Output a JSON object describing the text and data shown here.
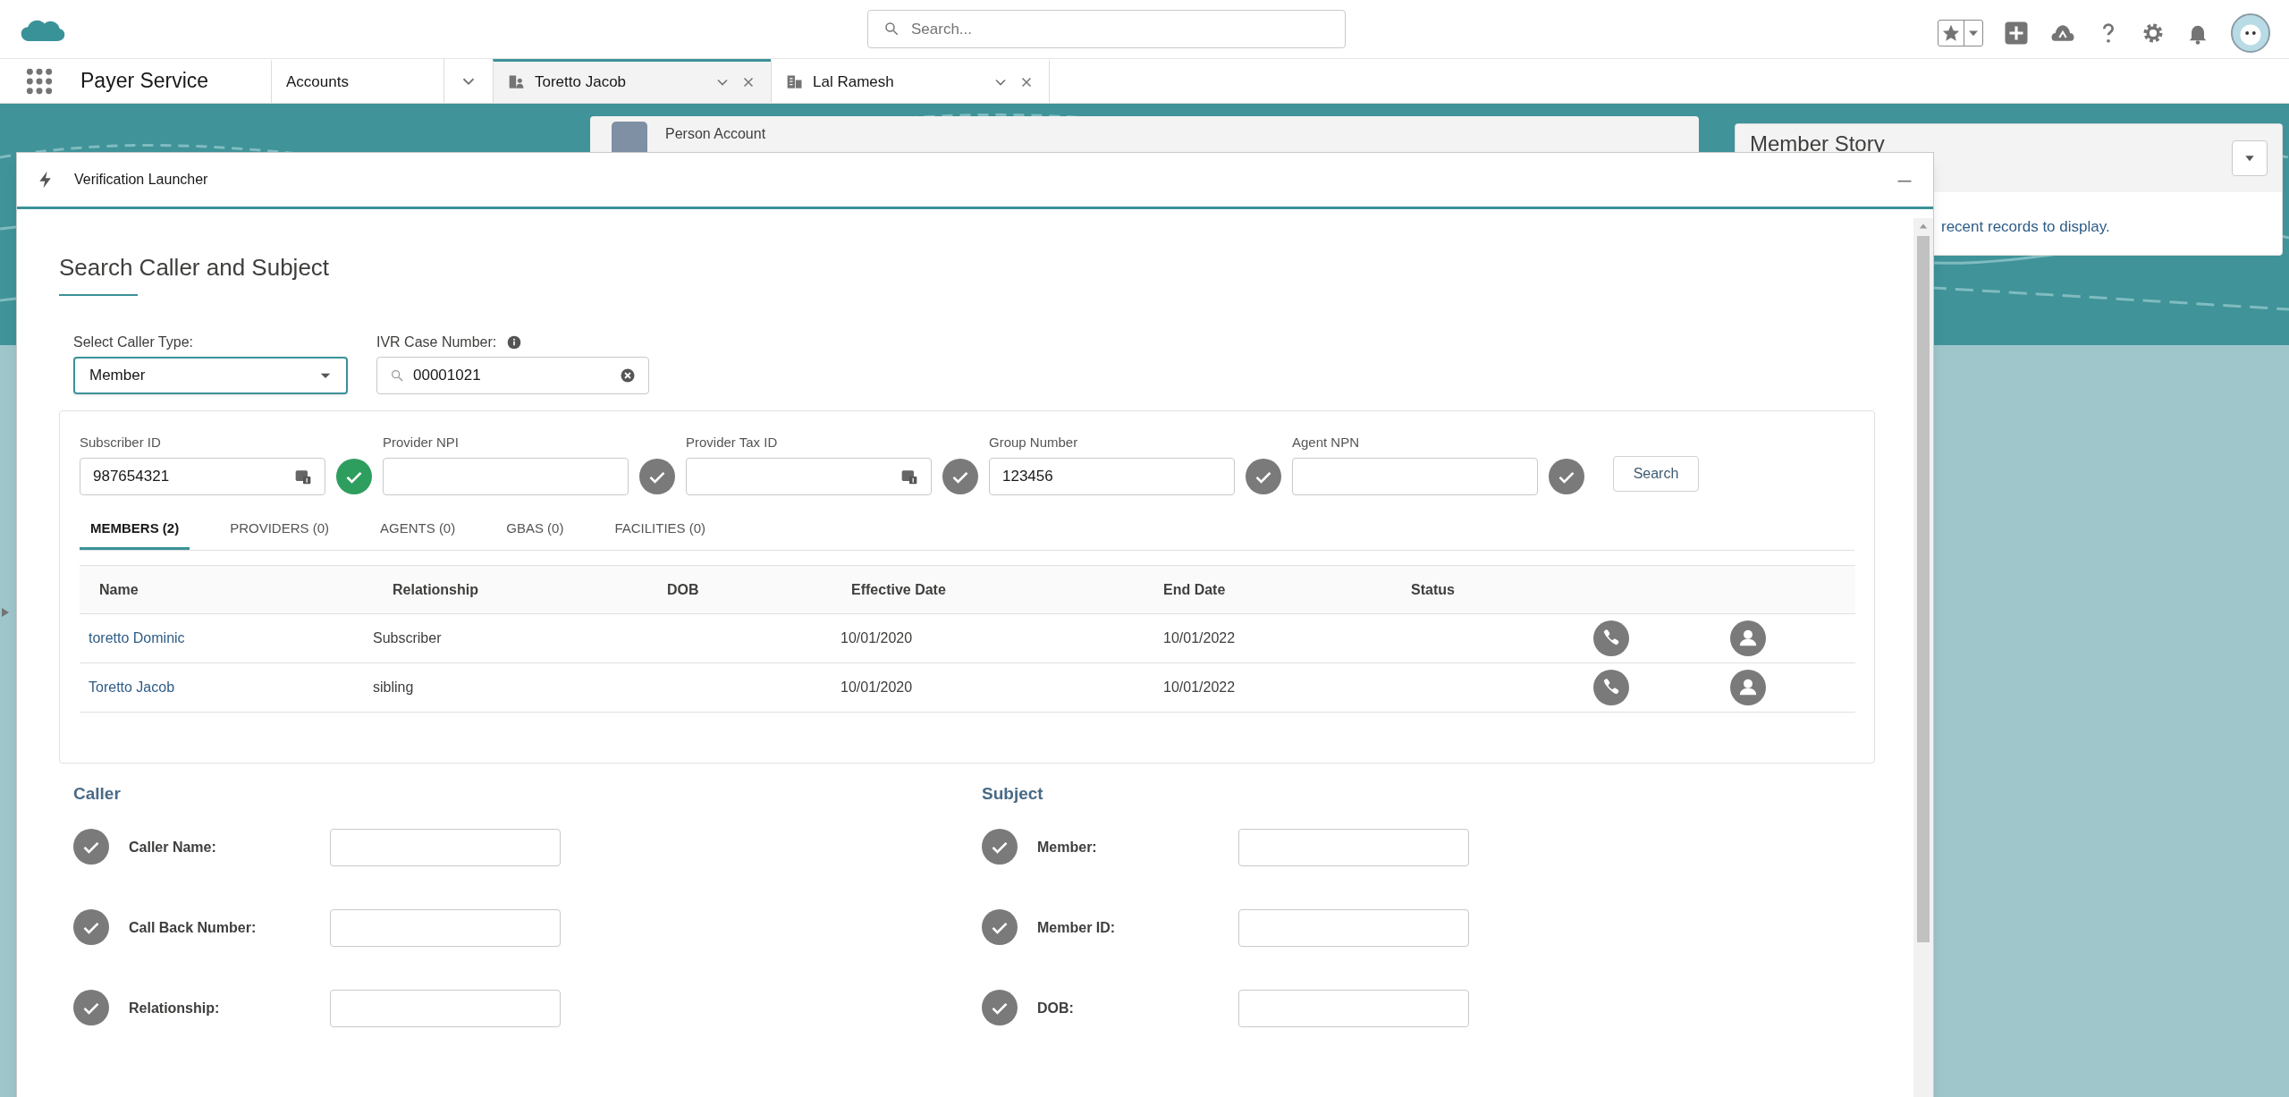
{
  "header": {
    "search": {
      "placeholder": "Search..."
    }
  },
  "nav": {
    "app_name": "Payer Service",
    "tabs": [
      {
        "label": "Accounts",
        "kind": "object",
        "selected": false
      },
      {
        "label": "Toretto Jacob",
        "kind": "person",
        "selected": true
      },
      {
        "label": "Lal Ramesh",
        "kind": "business",
        "selected": false
      }
    ]
  },
  "person_account": {
    "label": "Person Account"
  },
  "member_story": {
    "title": "Member Story",
    "message": "recent records to display."
  },
  "modal": {
    "title": "Verification Launcher",
    "heading": "Search Caller and Subject",
    "caller_type": {
      "label": "Select Caller Type:",
      "value": "Member"
    },
    "ivr": {
      "label": "IVR Case Number:",
      "value": "00001021"
    },
    "search_fields": [
      {
        "label": "Subscriber ID",
        "value": "987654321",
        "lookup": true,
        "verified": true
      },
      {
        "label": "Provider NPI",
        "lookup": false,
        "verified": false
      },
      {
        "label": "Provider Tax ID",
        "lookup": true,
        "verified": false
      },
      {
        "label": "Group Number",
        "value": "123456",
        "lookup": false,
        "verified": false
      },
      {
        "label": "Agent NPN",
        "lookup": false,
        "verified": false
      }
    ],
    "search_button": "Search",
    "result_tabs": [
      {
        "label": "MEMBERS (2)",
        "selected": true
      },
      {
        "label": "PROVIDERS (0)",
        "selected": false
      },
      {
        "label": "AGENTS (0)",
        "selected": false
      },
      {
        "label": "GBAS (0)",
        "selected": false
      },
      {
        "label": "FACILITIES (0)",
        "selected": false
      }
    ],
    "table": {
      "columns": [
        "Name",
        "Relationship",
        "DOB",
        "Effective Date",
        "End Date",
        "Status"
      ],
      "rows": [
        {
          "name": "toretto Dominic",
          "relationship": "Subscriber",
          "effective_date": "10/01/2020",
          "end_date": "10/01/2022"
        },
        {
          "name": "Toretto Jacob",
          "relationship": "sibling",
          "effective_date": "10/01/2020",
          "end_date": "10/01/2022"
        }
      ]
    },
    "caller": {
      "title": "Caller",
      "fields": [
        {
          "label": "Caller Name:"
        },
        {
          "label": "Call Back Number:"
        },
        {
          "label": "Relationship:"
        }
      ]
    },
    "subject": {
      "title": "Subject",
      "fields": [
        {
          "label": "Member:"
        },
        {
          "label": "Member ID:"
        },
        {
          "label": "DOB:"
        }
      ]
    }
  }
}
